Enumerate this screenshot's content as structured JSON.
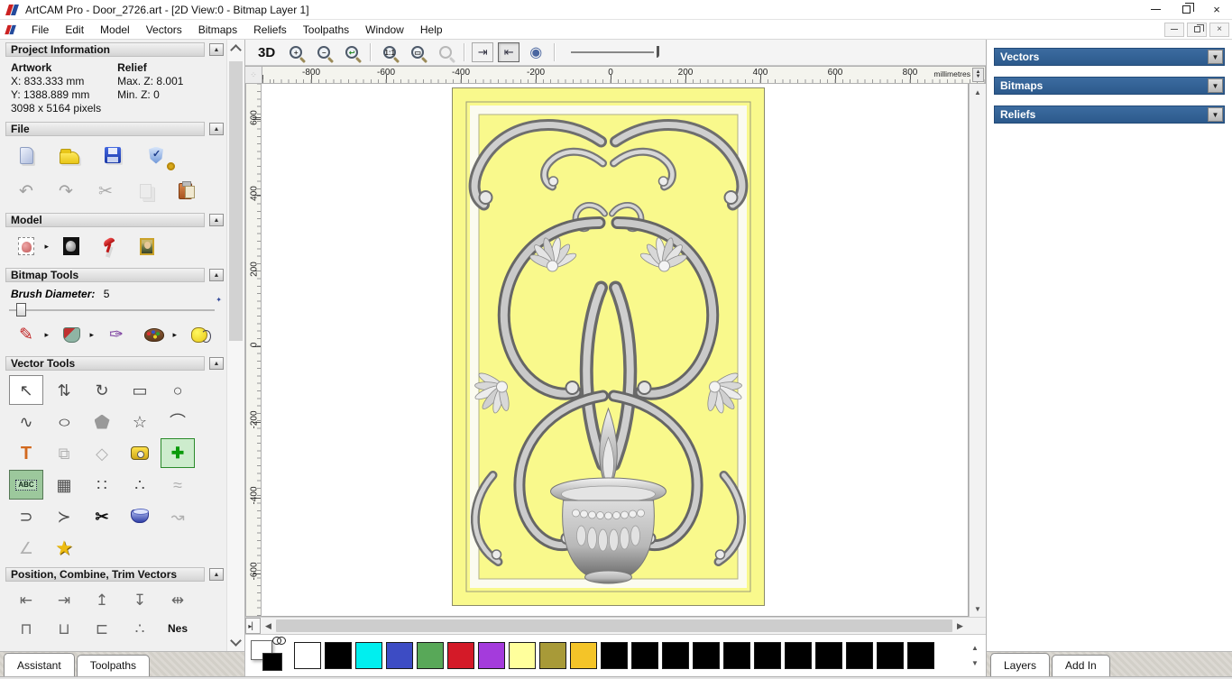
{
  "window": {
    "title": "ArtCAM Pro - Door_2726.art - [2D View:0 - Bitmap Layer 1]"
  },
  "menu": {
    "items": [
      {
        "n": "menu-file",
        "label": "File"
      },
      {
        "n": "menu-edit",
        "label": "Edit"
      },
      {
        "n": "menu-model",
        "label": "Model"
      },
      {
        "n": "menu-vectors",
        "label": "Vectors"
      },
      {
        "n": "menu-bitmaps",
        "label": "Bitmaps"
      },
      {
        "n": "menu-reliefs",
        "label": "Reliefs"
      },
      {
        "n": "menu-toolpaths",
        "label": "Toolpaths"
      },
      {
        "n": "menu-window",
        "label": "Window"
      },
      {
        "n": "menu-help",
        "label": "Help"
      }
    ]
  },
  "assistant": {
    "project_information": {
      "title": "Project Information",
      "artwork_label": "Artwork",
      "artwork_x": "X: 833.333 mm",
      "artwork_y": "Y: 1388.889 mm",
      "artwork_pixels": "3098 x 5164 pixels",
      "relief_label": "Relief",
      "relief_max": "Max. Z: 8.001",
      "relief_min": "Min. Z: 0"
    },
    "file": {
      "title": "File",
      "icons_row1": [
        {
          "n": "new-model-icon",
          "cls": "shape",
          "shape": "sh-page"
        },
        {
          "n": "open-model-icon",
          "cls": "shape",
          "shape": "sh-folder"
        },
        {
          "n": "save-model-icon",
          "cls": "shape",
          "shape": "sh-floppy"
        },
        {
          "n": "options-icon",
          "cls": "shape",
          "shape": "sh-shield",
          "extra": "sh-gear"
        }
      ],
      "icons_row2": [
        {
          "n": "undo-icon",
          "g": "↶",
          "c": "#a0a0a0"
        },
        {
          "n": "redo-icon",
          "g": "↷",
          "c": "#a0a0a0"
        },
        {
          "n": "cut-icon",
          "g": "✂",
          "c": "#ababab"
        },
        {
          "n": "copy-icon",
          "cls": "shape dim",
          "shape": "sh-copy"
        },
        {
          "n": "paste-icon",
          "cls": "shape",
          "shape": "sh-clip"
        }
      ]
    },
    "model": {
      "title": "Model",
      "icons": [
        {
          "n": "set-model-size-icon",
          "cls": "shape hasarrow",
          "shape": "sh-bearpage"
        },
        {
          "n": "adjust-model-icon",
          "cls": "shape",
          "shape": "sh-beardark"
        },
        {
          "n": "lighting-icon",
          "cls": "shape",
          "shape": "sh-lamp"
        },
        {
          "n": "texture-relief-icon",
          "cls": "shape",
          "shape": "sh-mona"
        }
      ]
    },
    "bitmap_tools": {
      "title": "Bitmap Tools",
      "brush_label": "Brush Diameter:",
      "brush_value": "5",
      "icons": [
        {
          "n": "paint-brush-icon",
          "g": "✎",
          "c": "#c02020",
          "cls": "hasarrow"
        },
        {
          "n": "flood-fill-icon",
          "cls": "shape hasarrow",
          "shape": "sh-bucket"
        },
        {
          "n": "colour-picker-icon",
          "g": "✑",
          "c": "#7a3d9e"
        },
        {
          "n": "colour-palette-icon",
          "cls": "shape hasarrow",
          "shape": "sh-palette2"
        },
        {
          "n": "link-colours-icon",
          "cls": "shape",
          "shape": "sh-blob"
        }
      ]
    },
    "vector_tools": {
      "title": "Vector Tools",
      "icons": [
        {
          "n": "select-vectors-icon",
          "g": "↖",
          "cls": "active"
        },
        {
          "n": "node-editing-icon",
          "g": "⇅"
        },
        {
          "n": "transform-vectors-icon",
          "g": "↻"
        },
        {
          "n": "create-rectangle-icon",
          "g": "▭"
        },
        {
          "n": "create-circle-icon",
          "g": "○"
        },
        {
          "n": "create-polyline-icon",
          "g": "∿"
        },
        {
          "n": "create-ellipse-icon",
          "g": "○",
          "cls": "wide"
        },
        {
          "n": "create-polygon-icon",
          "g": "⬠",
          "cls": "pent"
        },
        {
          "n": "create-star-icon",
          "g": "☆"
        },
        {
          "n": "create-arc-icon",
          "g": "⌒"
        },
        {
          "n": "create-text-icon",
          "g": "T",
          "c": "#d2691e",
          "cls": "bigbold"
        },
        {
          "n": "wrap-text-icon",
          "g": "⧉",
          "cls": "dim"
        },
        {
          "n": "distort-vector-icon",
          "g": "◇",
          "cls": "dim"
        },
        {
          "n": "measure-tool-icon",
          "cls": "shape",
          "shape": "sh-tape"
        },
        {
          "n": "block-paste-icon",
          "g": "✚",
          "c": "#0a9a0a",
          "cls": "greenplus"
        },
        {
          "n": "text-abc-icon",
          "g": "ABC",
          "cls": "abctile"
        },
        {
          "n": "envelope-distort-icon",
          "g": "▦"
        },
        {
          "n": "paste-along-curve-icon",
          "g": "∷"
        },
        {
          "n": "create-node-polyline-icon",
          "g": "∴"
        },
        {
          "n": "fit-arcs-icon",
          "g": "≈",
          "cls": "dim"
        },
        {
          "n": "blend-spans-icon",
          "g": "⊃"
        },
        {
          "n": "arrowhead-icon",
          "g": "≻"
        },
        {
          "n": "trim-vectors-icon",
          "g": "✂",
          "cls": "scis"
        },
        {
          "n": "two-rail-sweep-icon",
          "cls": "shape",
          "shape": "sh-bowl"
        },
        {
          "n": "edit-curve-icon",
          "g": "↝",
          "cls": "dim"
        },
        {
          "n": "cross-section-icon",
          "g": "∠",
          "cls": "dim"
        },
        {
          "n": "magic-wand-icon",
          "g": "★",
          "cls": "star"
        }
      ]
    },
    "position_tools": {
      "title": "Position, Combine, Trim Vectors",
      "icons": [
        {
          "n": "align-left-icon",
          "g": "⇤"
        },
        {
          "n": "align-right-icon",
          "g": "⇥"
        },
        {
          "n": "align-top-icon",
          "g": "↥"
        },
        {
          "n": "align-bottom-icon",
          "g": "↧"
        },
        {
          "n": "align-centre-icon",
          "g": "⇹"
        },
        {
          "n": "centre-vertical-icon",
          "g": "⊓"
        },
        {
          "n": "centre-horizontal-icon",
          "g": "⊔"
        },
        {
          "n": "centre-in-page-icon",
          "g": "⊏"
        },
        {
          "n": "scatter-copies-icon",
          "g": "∴"
        },
        {
          "n": "nesting-icon",
          "g": "Nes",
          "cls": "nestext"
        }
      ]
    },
    "tabs": [
      {
        "n": "tab-assistant",
        "label": "Assistant",
        "cls": "active"
      },
      {
        "n": "tab-toolpaths",
        "label": "Toolpaths"
      }
    ]
  },
  "toolbar": {
    "view_3d_label": "3D",
    "items": [
      {
        "n": "zoom-in-icon",
        "cls": "magtile",
        "g": "+"
      },
      {
        "n": "zoom-out-icon",
        "cls": "magtile",
        "g": "−"
      },
      {
        "n": "zoom-previous-icon",
        "cls": "magtile",
        "g": "↩",
        "gc": "#2a8a2a"
      },
      {
        "n": "toolbar-separator",
        "cls": "sep"
      },
      {
        "n": "zoom-1to1-icon",
        "cls": "magtile",
        "g": "1:1"
      },
      {
        "n": "zoom-fit-icon",
        "cls": "magtile",
        "g": "▭"
      },
      {
        "n": "zoom-selection-icon",
        "cls": "magtile dim",
        "g": ""
      },
      {
        "n": "toolbar-separator",
        "cls": "sep"
      },
      {
        "n": "show-bitmap-icon",
        "cls": "pagebtn",
        "g": "⇥"
      },
      {
        "n": "show-vectors-icon",
        "cls": "pagebtn pressed",
        "g": "⇤"
      },
      {
        "n": "greyscale-view-icon",
        "cls": "lens",
        "g": "◉",
        "gc": "#4a66a0"
      },
      {
        "n": "toolbar-separator",
        "cls": "sep"
      },
      {
        "n": "contrast-slider",
        "cls": "slider"
      }
    ]
  },
  "rulers": {
    "unit_label": "millimetres",
    "h_labels": [
      {
        "v": "-800"
      },
      {
        "v": "-600"
      },
      {
        "v": "-400"
      },
      {
        "v": "-200"
      },
      {
        "v": "0"
      },
      {
        "v": "200"
      },
      {
        "v": "400"
      },
      {
        "v": "600"
      },
      {
        "v": "800"
      }
    ],
    "v_labels": [
      {
        "v": "600"
      },
      {
        "v": "400"
      },
      {
        "v": "200"
      },
      {
        "v": "0"
      },
      {
        "v": "-200"
      },
      {
        "v": "-400"
      },
      {
        "v": "-600"
      }
    ]
  },
  "right_panel": {
    "headers": [
      {
        "n": "vectors-header",
        "label": "Vectors"
      },
      {
        "n": "bitmaps-header",
        "label": "Bitmaps"
      },
      {
        "n": "reliefs-header",
        "label": "Reliefs"
      }
    ],
    "tabs": [
      {
        "n": "tab-layers",
        "label": "Layers",
        "cls": "active"
      },
      {
        "n": "tab-add-in",
        "label": "Add In"
      }
    ]
  },
  "palette": {
    "swatches": [
      {
        "n": "swatch-white",
        "c": "#ffffff"
      },
      {
        "n": "swatch-black",
        "c": "#000000"
      },
      {
        "n": "swatch-cyan",
        "c": "#00efef"
      },
      {
        "n": "swatch-blue",
        "c": "#3d4cc4"
      },
      {
        "n": "swatch-green",
        "c": "#58a858"
      },
      {
        "n": "swatch-red",
        "c": "#d41a28"
      },
      {
        "n": "swatch-purple",
        "c": "#a43bdc"
      },
      {
        "n": "swatch-pale-yellow",
        "c": "#ffff9c"
      },
      {
        "n": "swatch-olive",
        "c": "#a89a38"
      },
      {
        "n": "swatch-gold",
        "c": "#f4c428"
      },
      {
        "n": "swatch-black",
        "c": "#000000"
      },
      {
        "n": "swatch-black",
        "c": "#000000"
      },
      {
        "n": "swatch-black",
        "c": "#000000"
      },
      {
        "n": "swatch-black",
        "c": "#000000"
      },
      {
        "n": "swatch-black",
        "c": "#000000"
      },
      {
        "n": "swatch-black",
        "c": "#000000"
      },
      {
        "n": "swatch-black",
        "c": "#000000"
      },
      {
        "n": "swatch-black",
        "c": "#000000"
      },
      {
        "n": "swatch-black",
        "c": "#000000"
      },
      {
        "n": "swatch-black",
        "c": "#000000"
      },
      {
        "n": "swatch-black",
        "c": "#000000"
      }
    ]
  }
}
